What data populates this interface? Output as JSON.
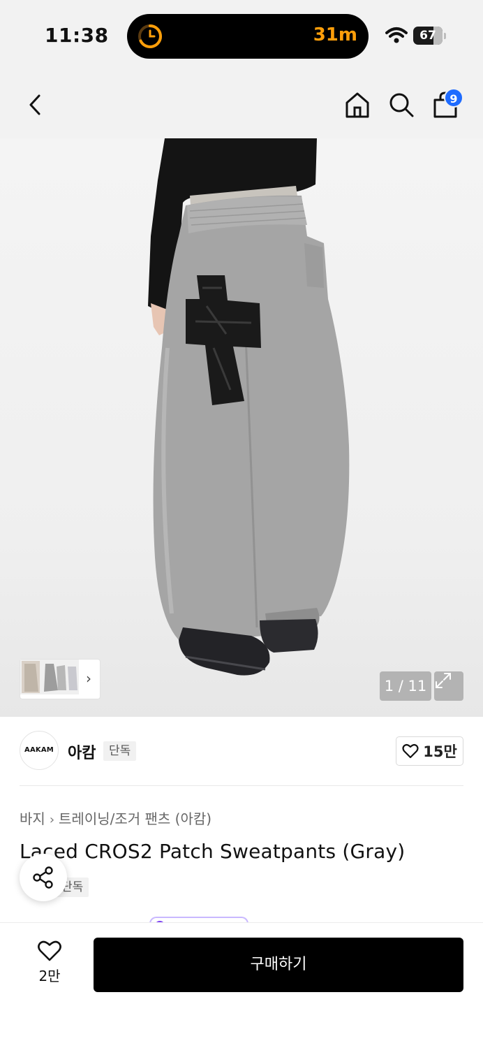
{
  "status_bar": {
    "time": "11:38",
    "activity_text": "31m",
    "battery_level": "67",
    "activity_color": "#ff9f0a"
  },
  "nav": {
    "back_icon": "chevron-left-icon",
    "home_icon": "home-icon",
    "search_icon": "search-icon",
    "cart_icon": "shopping-bag-icon",
    "cart_count": "9",
    "badge_color": "#1e6bff"
  },
  "gallery": {
    "page_counter": "1 / 11",
    "expand_icon": "expand-icon",
    "thumb_chevron": "›"
  },
  "brand": {
    "logo_text": "AAKAM",
    "name": "아캄",
    "exclusive_badge": "단독",
    "likes": "15만"
  },
  "product": {
    "breadcrumb": [
      "바지",
      "트레이닝/조거 팬츠 (아캄)"
    ],
    "title": "Laced CROS2 Patch Sweatpants (Gray)",
    "tag": "단독"
  },
  "bottom_bar": {
    "wish_count": "2만",
    "buy_label": "구매하기"
  }
}
